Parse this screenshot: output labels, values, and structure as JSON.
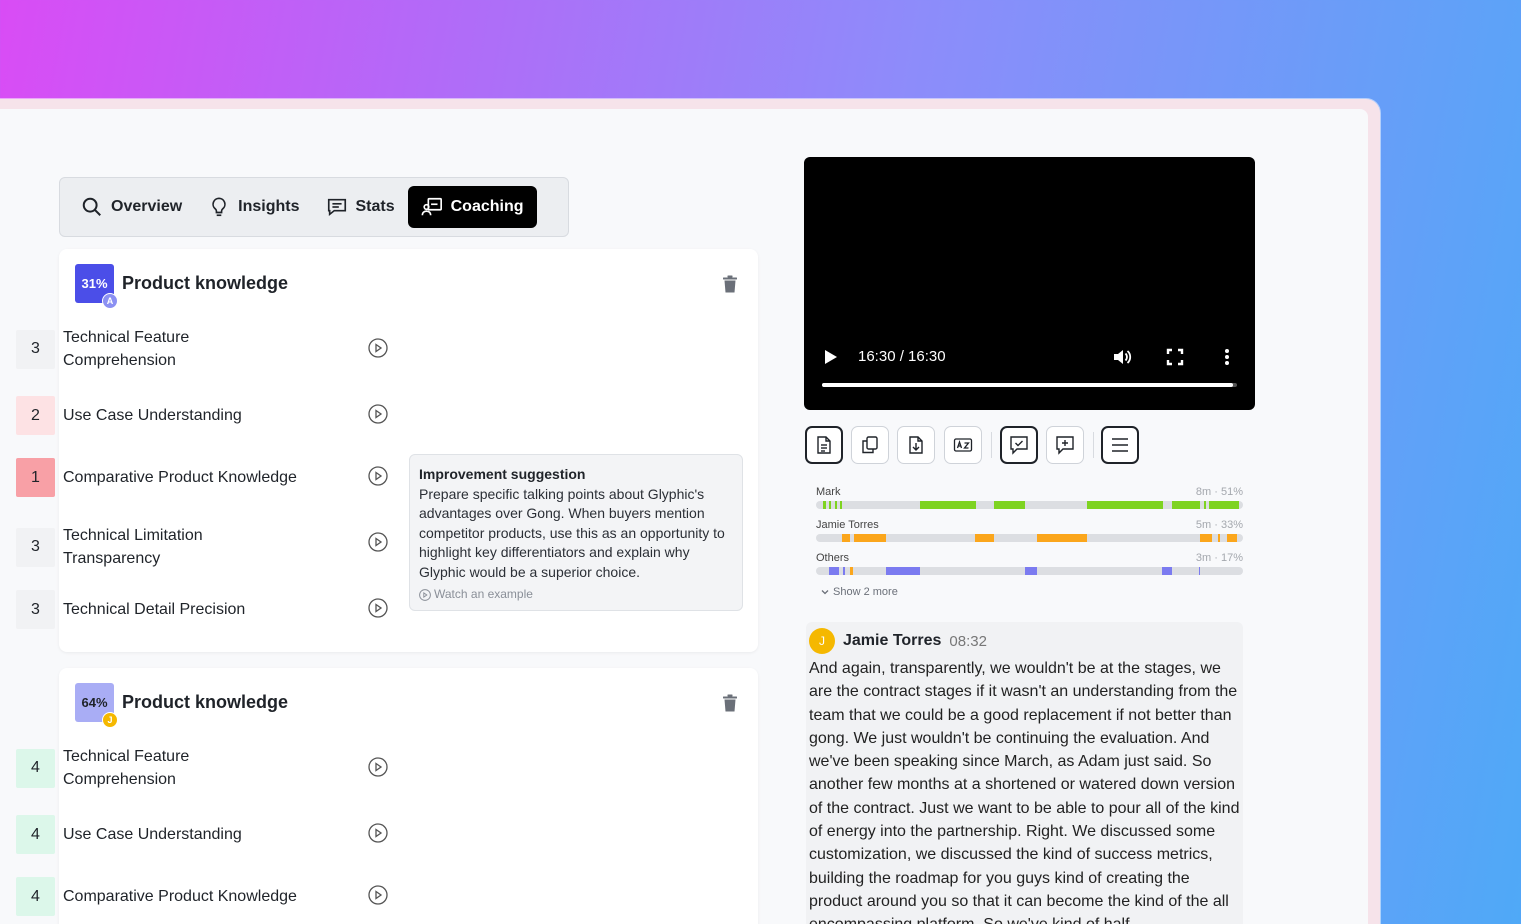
{
  "tabs": [
    {
      "label": "Overview",
      "icon": "search-icon"
    },
    {
      "label": "Insights",
      "icon": "lightbulb-icon"
    },
    {
      "label": "Stats",
      "icon": "chat-icon"
    },
    {
      "label": "Coaching",
      "icon": "coaching-icon",
      "active": true
    }
  ],
  "cards": [
    {
      "percent": "31%",
      "avatar": "A",
      "title": "Product knowledge",
      "color": "#4b4ee8",
      "avatar_color": "#8b90f2",
      "criteria": [
        {
          "score": "3",
          "label": "Technical Feature Comprehension",
          "bg": "#f1f2f4"
        },
        {
          "score": "2",
          "label": "Use Case Understanding",
          "bg": "#fde2e4"
        },
        {
          "score": "1",
          "label": "Comparative Product Knowledge",
          "bg": "#f8a0a6"
        },
        {
          "score": "3",
          "label": "Technical Limitation Transparency",
          "bg": "#f1f2f4"
        },
        {
          "score": "3",
          "label": "Technical Detail Precision",
          "bg": "#f1f2f4"
        }
      ]
    },
    {
      "percent": "64%",
      "avatar": "J",
      "title": "Product knowledge",
      "color": "#a9adf5",
      "avatar_color": "#f5b800",
      "criteria": [
        {
          "score": "4",
          "label": "Technical Feature Comprehension",
          "bg": "#dcf7ea"
        },
        {
          "score": "4",
          "label": "Use Case Understanding",
          "bg": "#dcf7ea"
        },
        {
          "score": "4",
          "label": "Comparative Product Knowledge",
          "bg": "#dcf7ea"
        }
      ]
    }
  ],
  "tooltip": {
    "title": "Improvement suggestion",
    "body": "Prepare specific talking points about Glyphic's advantages over Gong. When buyers mention competitor products, use this as an opportunity to highlight key differentiators and explain why Glyphic would be a superior choice.",
    "watch": "Watch an example"
  },
  "video": {
    "time": "16:30 / 16:30",
    "progress": 0.99
  },
  "speakers": [
    {
      "name": "Mark",
      "stat": "8m · 51%",
      "color": "#7ed321"
    },
    {
      "name": "Jamie Torres",
      "stat": "5m · 33%",
      "color": "#fba61c"
    },
    {
      "name": "Others",
      "stat": "3m · 17%",
      "color": "#7b7bf0"
    }
  ],
  "show_more": "Show 2 more",
  "transcript": {
    "avatar": "J",
    "speaker": "Jamie Torres",
    "time": "08:32",
    "text": "And again, transparently, we wouldn't be at the stages, we are the contract stages if it wasn't an understanding from the team that we could be a good replacement if not better than gong. We just wouldn't be continuing the evaluation. And we've been speaking since March, as Adam just said. So another few months at a shortened or watered down version of the contract. Just we want to be able to pour all of the kind of energy into the partnership. Right. We discussed some customization, we discussed the kind of success metrics, building the roadmap for you guys kind of creating the product around you so that it can become the kind of the all encompassing platform. So we've kind of half"
  }
}
